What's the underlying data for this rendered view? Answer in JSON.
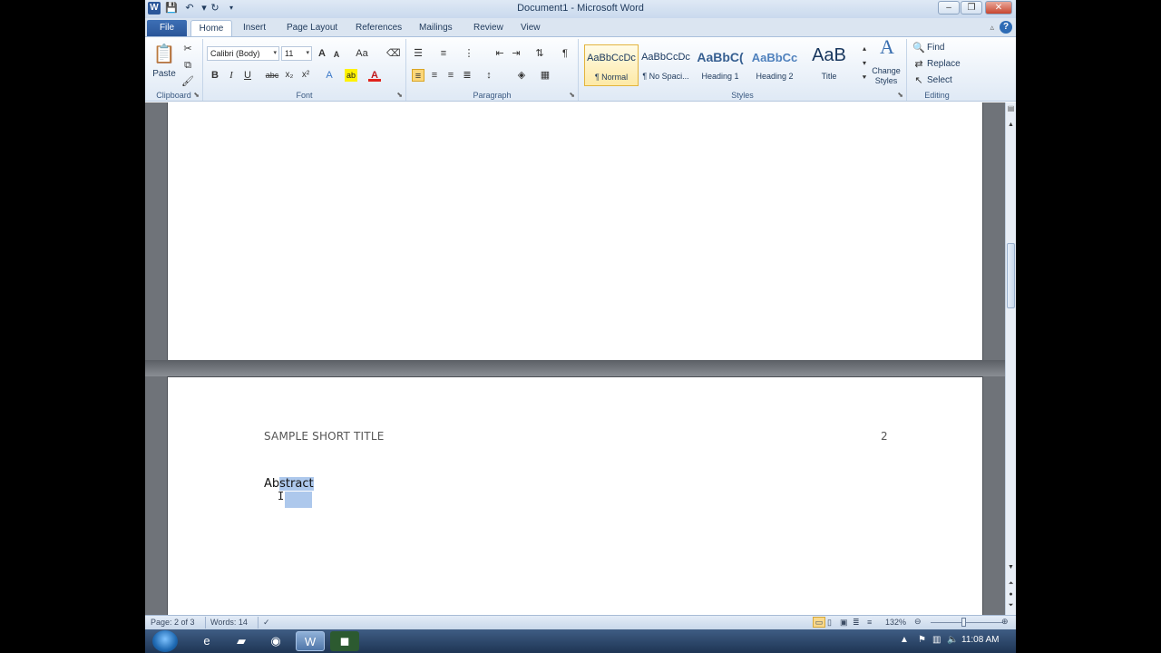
{
  "window": {
    "title": "Document1 - Microsoft Word",
    "app_icon": "W",
    "minimize": "–",
    "restore": "❐",
    "close": "✕"
  },
  "tabs": [
    {
      "label": "File"
    },
    {
      "label": "Home"
    },
    {
      "label": "Insert"
    },
    {
      "label": "Page Layout"
    },
    {
      "label": "References"
    },
    {
      "label": "Mailings"
    },
    {
      "label": "Review"
    },
    {
      "label": "View"
    }
  ],
  "ribbon": {
    "clipboard": {
      "label": "Clipboard",
      "paste": "Paste"
    },
    "font": {
      "label": "Font",
      "font_name": "Calibri (Body)",
      "font_size": "11",
      "bold": "B",
      "italic": "I",
      "underline": "U",
      "strikethrough": "abc",
      "subscript": "x₂",
      "superscript": "x²",
      "change_case": "Aa",
      "grow": "A",
      "shrink": "A"
    },
    "paragraph": {
      "label": "Paragraph",
      "show_marks": "¶"
    },
    "styles": {
      "label": "Styles",
      "items": [
        {
          "sample": "AaBbCcDc",
          "name": "¶ Normal"
        },
        {
          "sample": "AaBbCcDc",
          "name": "¶ No Spaci..."
        },
        {
          "sample": "AaBbC(",
          "name": "Heading 1"
        },
        {
          "sample": "AaBbCc",
          "name": "Heading 2"
        },
        {
          "sample": "AaB",
          "name": "Title"
        }
      ],
      "change_styles": "Change Styles"
    },
    "editing": {
      "label": "Editing",
      "find": "Find",
      "replace": "Replace",
      "select": "Select"
    }
  },
  "document": {
    "running_head": "SAMPLE SHORT TITLE",
    "page_number": "2",
    "heading_unselected": "Ab",
    "heading_selected": "stract"
  },
  "status": {
    "page": "Page: 2 of 3",
    "words": "Words: 14",
    "zoom": "132%"
  },
  "taskbar": {
    "clock": "11:08 AM"
  }
}
